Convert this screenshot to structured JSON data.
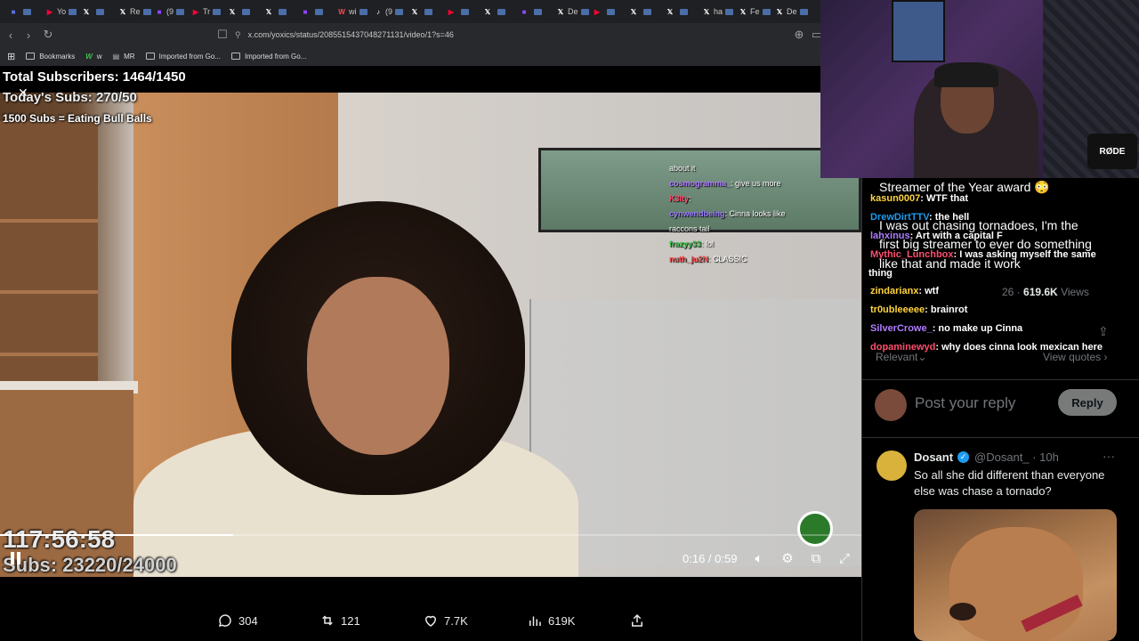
{
  "browser": {
    "tabs": [
      {
        "label": "",
        "icon": "tab-overview-icon",
        "color": "#5b6ee1"
      },
      {
        "label": "Yo",
        "icon": "youtube-icon",
        "color": "#ff0033"
      },
      {
        "label": "",
        "icon": "x-icon",
        "color": "#ffffff"
      },
      {
        "label": "Re",
        "icon": "x-icon",
        "color": "#ffffff"
      },
      {
        "label": "(9",
        "icon": "twitch-icon",
        "color": "#9146ff"
      },
      {
        "label": "Tr",
        "icon": "youtube-icon",
        "color": "#ff0033"
      },
      {
        "label": "",
        "icon": "x-icon",
        "color": "#ffffff"
      },
      {
        "label": "",
        "icon": "x-icon",
        "color": "#ffffff"
      },
      {
        "label": "",
        "icon": "twitch-icon",
        "color": "#9146ff"
      },
      {
        "label": "wi",
        "icon": "wikipedia-icon",
        "color": "#ff4d4d"
      },
      {
        "label": "(9",
        "icon": "tiktok-icon",
        "color": "#ffffff"
      },
      {
        "label": "",
        "icon": "x-icon",
        "color": "#ffffff"
      },
      {
        "label": "",
        "icon": "youtube-icon",
        "color": "#ff0033"
      },
      {
        "label": "",
        "icon": "x-icon",
        "color": "#ffffff"
      },
      {
        "label": "",
        "icon": "twitch-icon",
        "color": "#9146ff"
      },
      {
        "label": "De",
        "icon": "x-icon",
        "color": "#ffffff"
      },
      {
        "label": "",
        "icon": "youtube-icon",
        "color": "#ff0033"
      },
      {
        "label": "",
        "icon": "x-icon",
        "color": "#ffffff"
      },
      {
        "label": "",
        "icon": "x-icon",
        "color": "#ffffff"
      },
      {
        "label": "ha",
        "icon": "x-icon",
        "color": "#ffffff"
      },
      {
        "label": "Fe",
        "icon": "x-icon",
        "color": "#ffffff"
      },
      {
        "label": "De",
        "icon": "x-icon",
        "color": "#ffffff"
      }
    ],
    "url": "x.com/yoxics/status/2085515437048271131/video/1?s=46",
    "bookmarks": [
      {
        "label": "Bookmarks"
      },
      {
        "label": "w"
      },
      {
        "label": "MR"
      },
      {
        "label": "Imported from Go..."
      },
      {
        "label": "Imported from Go..."
      }
    ]
  },
  "stream_overlay": {
    "total_subs": "Total Subscribers: 1464/1450",
    "todays_subs": "Today's Subs: 270/50",
    "goal": "1500 Subs = Eating Bull Balls",
    "timer": "117:56:58",
    "subs_count": "Subs: 23220/24000"
  },
  "video_chat": [
    {
      "user": "",
      "msg": "about it"
    },
    {
      "user": "cosmogramma_",
      "msg": ": give us more",
      "color": "#b07cff"
    },
    {
      "user": "K3lty",
      "msg": ":",
      "color": "#ff4d6d"
    },
    {
      "user": "",
      "msg": "",
      "color": "#ff4d6d"
    },
    {
      "user": "cynwendbeing",
      "msg": ": Cinna looks like",
      "color": "#9c7cff"
    },
    {
      "user": "",
      "msg": "raccons tail"
    },
    {
      "user": "frazyy33",
      "msg": ": lol",
      "color": "#3fc14a"
    },
    {
      "user": "nuth_ju2N",
      "msg": ": CLASSIC",
      "color": "#ff4d4d"
    }
  ],
  "player": {
    "current_time": "0:16",
    "duration": "0:59",
    "progress": 0.271
  },
  "actions": {
    "replies": "304",
    "reposts": "121",
    "likes": "7.7K",
    "views": "619K"
  },
  "side_chat": [
    {
      "user": "",
      "msg": "Streamer of the Year award 😳",
      "color": "#ffffff"
    },
    {
      "user": "kasun0007",
      "msg": ": WTF that",
      "color": "#ffd43b"
    },
    {
      "user": "DrewDirtTTV",
      "msg": ": the hell",
      "color": "#1d9bf0"
    },
    {
      "user": "",
      "msg": "I was out chasing tornadoes, I'm the",
      "color": "#ffffff"
    },
    {
      "user": "lahxinus",
      "msg": ": Art with a capital F",
      "color": "#b07cff"
    },
    {
      "user": "",
      "msg": "first big streamer to ever do something",
      "color": "#ffffff"
    },
    {
      "user": "Mythic_Lunchbox",
      "msg": ": I was asking myself the same",
      "color": "#ff4d6d"
    },
    {
      "user": "",
      "msg": "like that and made it work",
      "color": "#ffffff"
    },
    {
      "user": "",
      "msg": "thing",
      "color": "#ffffff"
    },
    {
      "user": "zindarianx",
      "msg": ": wtf",
      "color": "#ffd43b"
    },
    {
      "user": "tr0ubleeeee",
      "msg": ": brainrot",
      "color": "#ffd43b"
    },
    {
      "user": "SilverCrowe_",
      "msg": ": no make up Cinna",
      "color": "#b07cff"
    },
    {
      "user": "dopaminewyd",
      "msg": ": why does cinna look mexican here",
      "color": "#ff4d6d"
    }
  ],
  "tweet": {
    "time_prefix": "26 ·",
    "views_count": "619.6K",
    "views_label": "Views",
    "relevant": "Relevant",
    "view_quotes": "View quotes",
    "reply_placeholder": "Post your reply",
    "reply_button": "Reply"
  },
  "reply": {
    "name": "Dosant",
    "handle": "@Dosant_ · 10h",
    "text": "So all she did different than everyone else was chase a tornado?"
  },
  "webcam": {
    "mic_label": "RØDE"
  }
}
